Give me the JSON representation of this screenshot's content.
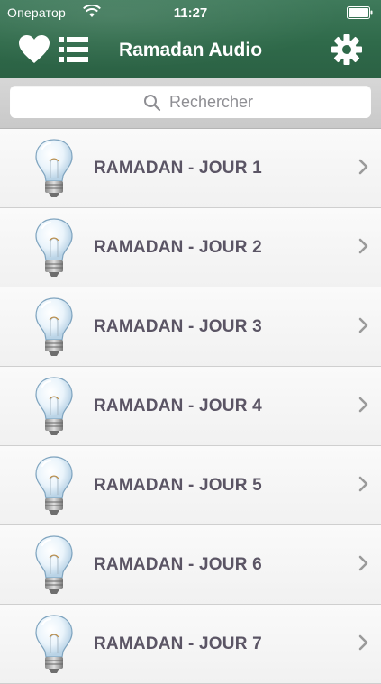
{
  "status_bar": {
    "carrier": "Оператор",
    "time": "11:27",
    "wifi_icon": "wifi-icon",
    "battery_icon": "battery-icon"
  },
  "nav": {
    "title": "Ramadan Audio",
    "favorites_icon": "heart-icon",
    "list_icon": "list-icon",
    "settings_icon": "gear-icon"
  },
  "search": {
    "placeholder": "Rechercher",
    "icon": "search-icon"
  },
  "list": {
    "items": [
      {
        "label": "RAMADAN - JOUR 1"
      },
      {
        "label": "RAMADAN - JOUR 2"
      },
      {
        "label": "RAMADAN - JOUR 3"
      },
      {
        "label": "RAMADAN - JOUR 4"
      },
      {
        "label": "RAMADAN - JOUR 5"
      },
      {
        "label": "RAMADAN - JOUR 6"
      },
      {
        "label": "RAMADAN - JOUR 7"
      }
    ],
    "item_icon": "lightbulb-icon",
    "disclosure_icon": "chevron-right-icon"
  },
  "colors": {
    "header_green": "#2f6a4a",
    "label_text": "#5b5565",
    "chevron": "#9a9a9a"
  }
}
